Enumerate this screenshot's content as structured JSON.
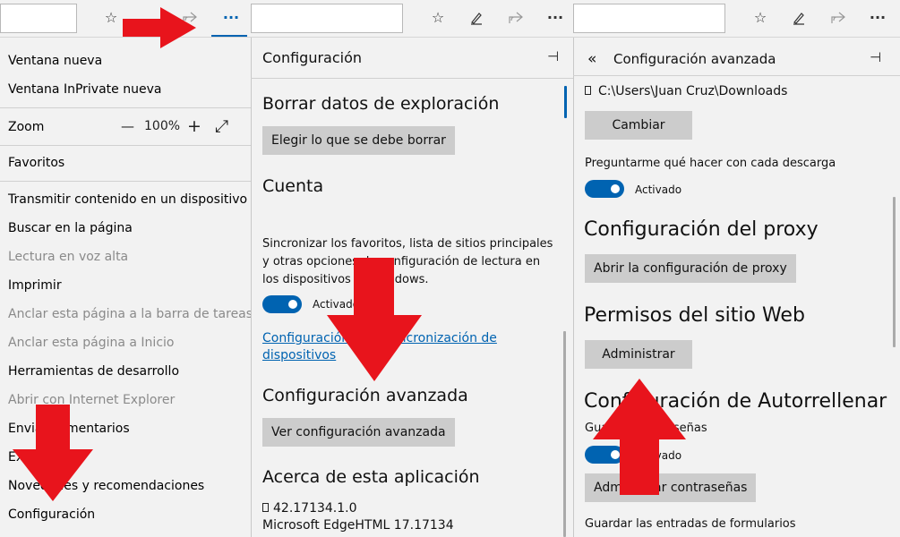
{
  "toolbar": {
    "icons": [
      "star-icon",
      "pen-icon",
      "share-icon",
      "more-icon"
    ],
    "more_label": "···"
  },
  "menu": {
    "items": [
      {
        "label": "Ventana nueva",
        "disabled": false
      },
      {
        "label": "Ventana InPrivate nueva",
        "disabled": false
      },
      {
        "label": "Zoom",
        "disabled": false
      },
      {
        "label": "Favoritos",
        "disabled": false
      },
      {
        "label": "Transmitir contenido en un dispositivo",
        "disabled": false
      },
      {
        "label": "Buscar en la página",
        "disabled": false
      },
      {
        "label": "Lectura en voz alta",
        "disabled": true
      },
      {
        "label": "Imprimir",
        "disabled": false
      },
      {
        "label": "Anclar esta página a la barra de tareas",
        "disabled": true
      },
      {
        "label": "Anclar esta página a Inicio",
        "disabled": true
      },
      {
        "label": "Herramientas de desarrollo",
        "disabled": false
      },
      {
        "label": "Abrir con Internet Explorer",
        "disabled": true
      },
      {
        "label": "Enviar comentarios",
        "disabled": false
      },
      {
        "label": "Extensiones",
        "disabled": false
      },
      {
        "label": "Novedades y recomendaciones",
        "disabled": false
      },
      {
        "label": "Configuración",
        "disabled": false
      }
    ],
    "zoom": {
      "minus": "—",
      "value": "100%",
      "plus": "+",
      "fullscreen": "⤢"
    }
  },
  "settings": {
    "title": "Configuración",
    "clear_heading": "Borrar datos de exploración",
    "clear_button": "Elegir lo que se debe borrar",
    "account_heading": "Cuenta",
    "sync_text": "Sincronizar los favoritos, lista de sitios principales y otras opciones de configuración de lectura en los dispositivos de Windows.",
    "toggle_label": "Activado",
    "sync_link": "Configuración de la sincronización de dispositivos",
    "advanced_heading": "Configuración avanzada",
    "advanced_button": "Ver configuración avanzada",
    "about_heading": "Acerca de esta aplicación",
    "version": "42.17134.1.0",
    "edgehtml": "Microsoft EdgeHTML 17.17134"
  },
  "advanced": {
    "back": "«",
    "title": "Configuración avanzada",
    "download_path": "C:\\Users\\Juan Cruz\\Downloads",
    "change_button": "Cambiar",
    "ask_label": "Preguntarme qué hacer con cada descarga",
    "toggle_label": "Activado",
    "proxy_heading": "Configuración del proxy",
    "proxy_button": "Abrir la configuración de proxy",
    "site_heading": "Permisos del sitio Web",
    "site_button": "Administrar",
    "autofill_heading": "Configuración de Autorrellenar",
    "save_passwords": "Guardar contraseñas",
    "toggle_label2": "Activado",
    "manage_passwords": "Administrar contraseñas",
    "save_forms": "Guardar las entradas de formularios"
  },
  "colors": {
    "accent": "#0063b1",
    "arrow": "#e8141c",
    "button": "#cccccc"
  }
}
